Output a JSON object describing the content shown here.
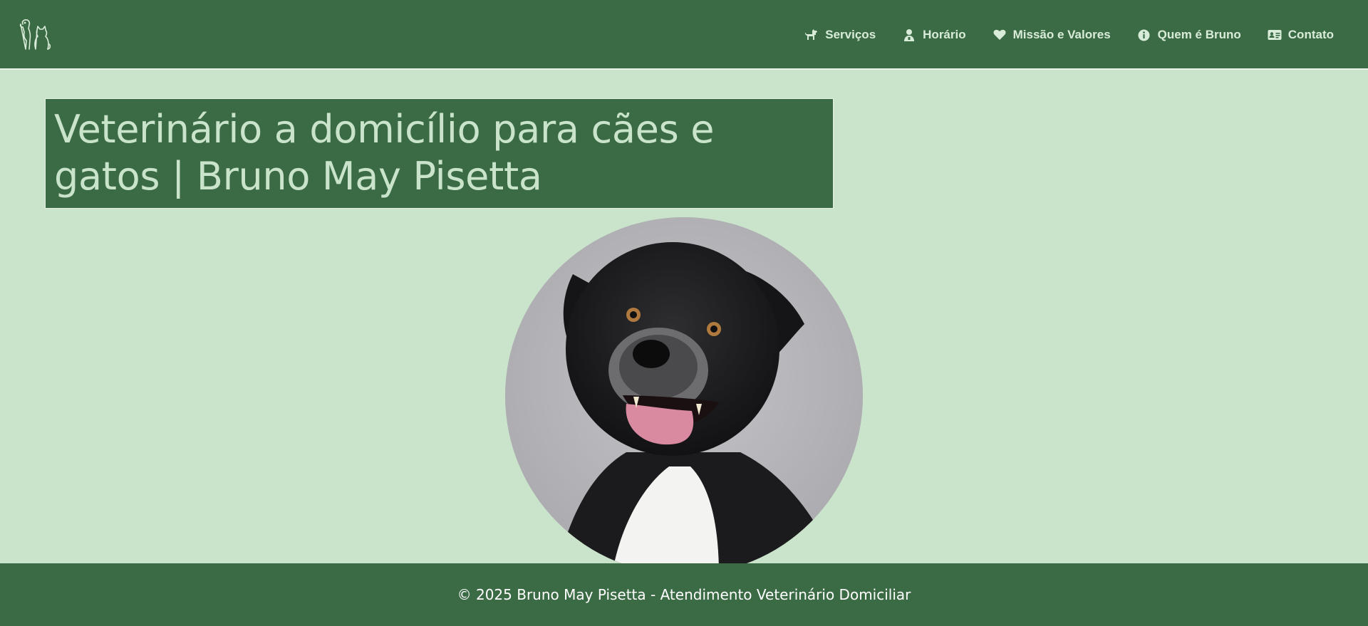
{
  "header": {
    "logo_icon": "dog-and-cat-outline-icon",
    "nav": [
      {
        "label": "Serviços",
        "icon": "dog-icon"
      },
      {
        "label": "Horário",
        "icon": "user-doctor-icon"
      },
      {
        "label": "Missão e Valores",
        "icon": "heart-icon"
      },
      {
        "label": "Quem é Bruno",
        "icon": "info-circle-icon"
      },
      {
        "label": "Contato",
        "icon": "id-card-icon"
      }
    ]
  },
  "hero": {
    "title": "Veterinário a domicílio para cães e gatos | Bruno May Pisetta",
    "image": "portrait-black-white-dog"
  },
  "footer": {
    "copyright": "© 2025 Bruno May Pisetta - Atendimento Veterinário Domiciliar"
  },
  "colors": {
    "primary_green": "#3b6b45",
    "light_green": "#c9e4ca",
    "nav_text": "#d9ecd9",
    "footer_text": "#ffffff"
  }
}
